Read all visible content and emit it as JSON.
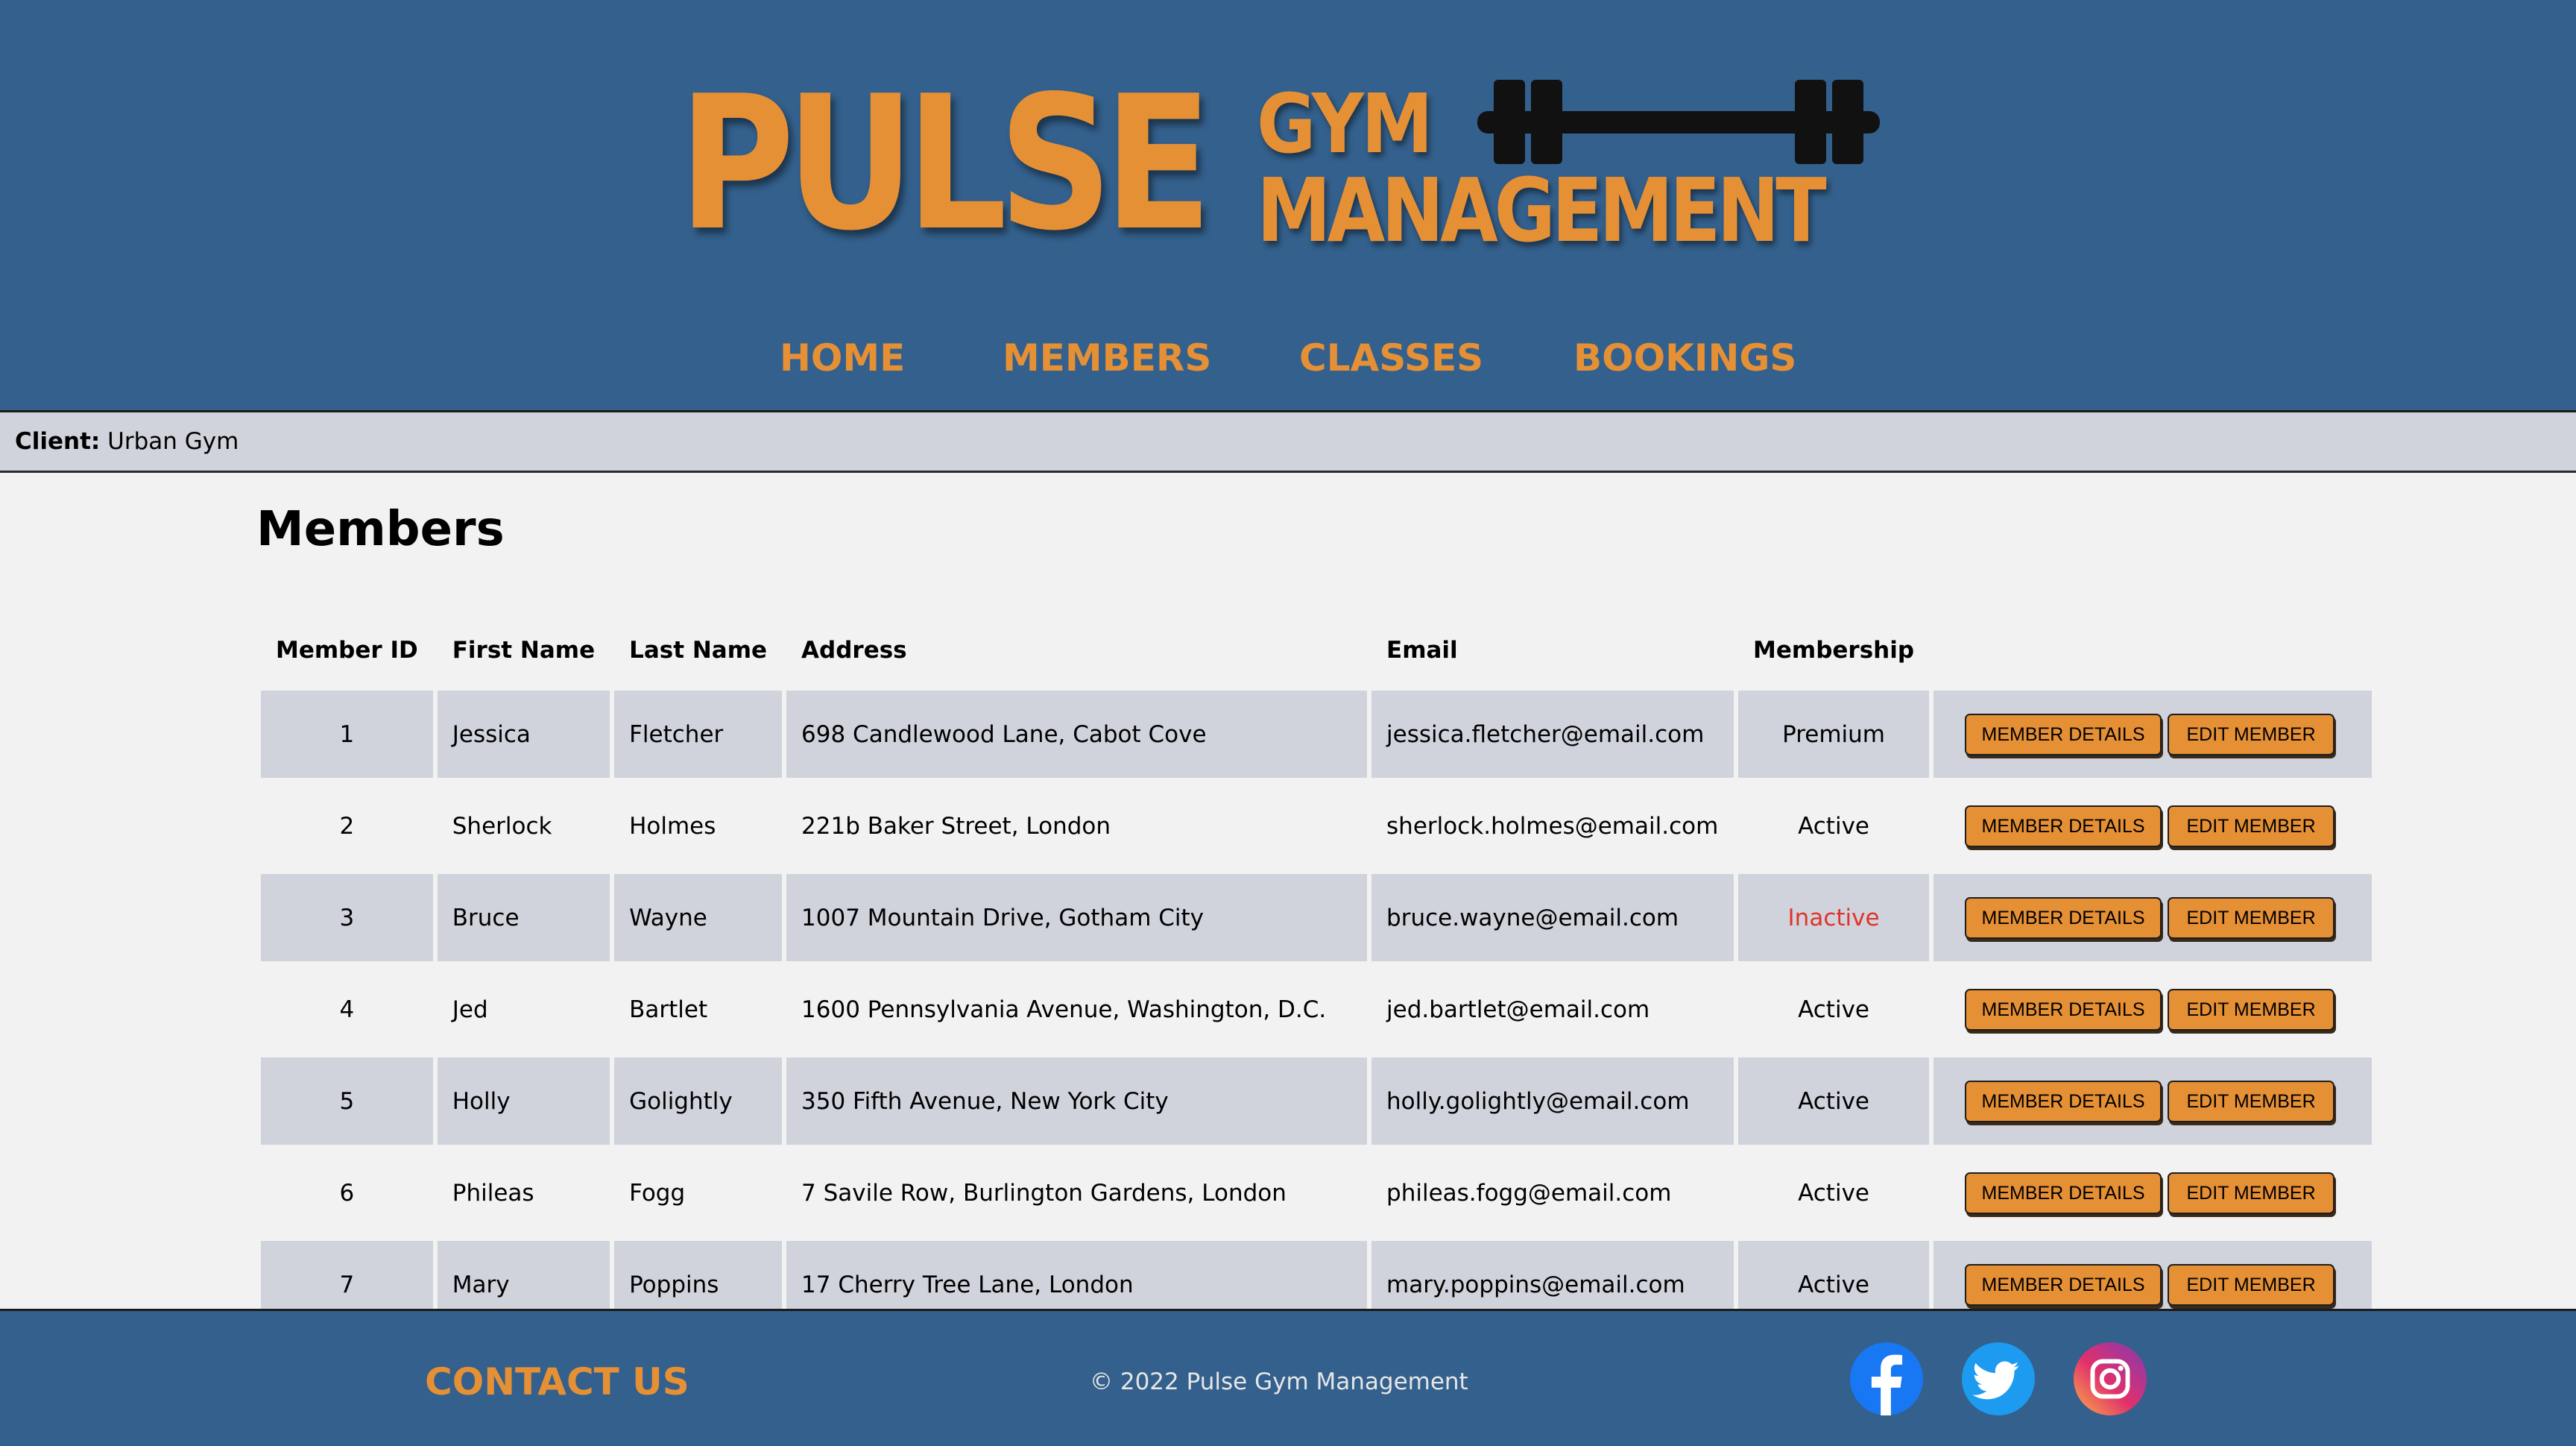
{
  "brand": {
    "name_main": "PULSE",
    "name_gym": "GYM",
    "name_management": "MANAGEMENT"
  },
  "nav": {
    "items": [
      {
        "label": "HOME"
      },
      {
        "label": "MEMBERS"
      },
      {
        "label": "CLASSES"
      },
      {
        "label": "BOOKINGS"
      }
    ]
  },
  "client": {
    "label": "Client:",
    "value": "Urban Gym"
  },
  "page": {
    "title": "Members"
  },
  "table": {
    "headers": [
      "Member ID",
      "First Name",
      "Last Name",
      "Address",
      "Email",
      "Membership"
    ],
    "details_button": "MEMBER DETAILS",
    "edit_button": "EDIT MEMBER",
    "rows": [
      {
        "id": "1",
        "first": "Jessica",
        "last": "Fletcher",
        "address": "698 Candlewood Lane, Cabot Cove",
        "email": "jessica.fletcher@email.com",
        "membership": "Premium"
      },
      {
        "id": "2",
        "first": "Sherlock",
        "last": "Holmes",
        "address": "221b Baker Street, London",
        "email": "sherlock.holmes@email.com",
        "membership": "Active"
      },
      {
        "id": "3",
        "first": "Bruce",
        "last": "Wayne",
        "address": "1007 Mountain Drive, Gotham City",
        "email": "bruce.wayne@email.com",
        "membership": "Inactive"
      },
      {
        "id": "4",
        "first": "Jed",
        "last": "Bartlet",
        "address": "1600 Pennsylvania Avenue, Washington, D.C.",
        "email": "jed.bartlet@email.com",
        "membership": "Active"
      },
      {
        "id": "5",
        "first": "Holly",
        "last": "Golightly",
        "address": "350 Fifth Avenue, New York City",
        "email": "holly.golightly@email.com",
        "membership": "Active"
      },
      {
        "id": "6",
        "first": "Phileas",
        "last": "Fogg",
        "address": "7 Savile Row, Burlington Gardens, London",
        "email": "phileas.fogg@email.com",
        "membership": "Active"
      },
      {
        "id": "7",
        "first": "Mary",
        "last": "Poppins",
        "address": "17 Cherry Tree Lane, London",
        "email": "mary.poppins@email.com",
        "membership": "Active"
      }
    ]
  },
  "footer": {
    "contact_label": "CONTACT US",
    "copyright": "© 2022 Pulse Gym Management",
    "social": [
      {
        "icon": "facebook-icon"
      },
      {
        "icon": "twitter-icon"
      },
      {
        "icon": "instagram-icon"
      }
    ]
  },
  "colors": {
    "header_bg": "#33608c",
    "accent": "#e69036",
    "row_shade": "#d0d3dc",
    "page_bg": "#f2f2f2",
    "inactive": "#e0342a"
  }
}
